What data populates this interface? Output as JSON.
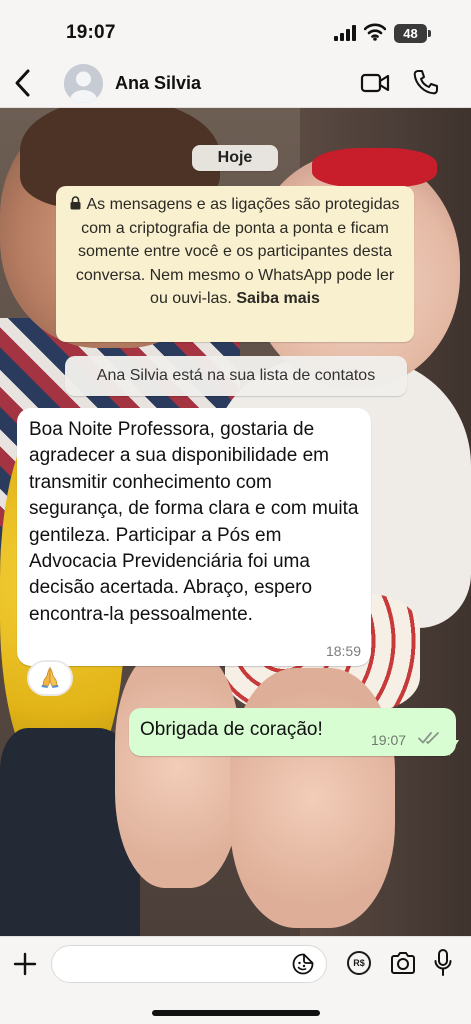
{
  "status_bar": {
    "time": "19:07",
    "battery_level": "48",
    "icons": [
      "signal-icon",
      "wifi-icon",
      "battery-icon"
    ]
  },
  "header": {
    "contact_name": "Ana Silvia",
    "icons": [
      "back-arrow-icon",
      "avatar-icon",
      "video-call-icon",
      "phone-icon"
    ]
  },
  "chat": {
    "date_chip": "Hoje",
    "encryption_notice": {
      "text": "As mensagens e as ligações são protegidas com a criptografia de ponta a ponta e ficam somente entre você e os participantes desta conversa. Nem mesmo o WhatsApp pode ler ou ouvi-las.",
      "link": "Saiba mais"
    },
    "contact_notice": "Ana Silvia está na sua lista de contatos",
    "messages": [
      {
        "direction": "incoming",
        "text": "Boa Noite Professora, gostaria de agradecer a sua disponibilidade em transmitir conhecimento com segurança, de forma clara e com muita gentileza. Participar a Pós em Advocacia Previdenciária foi uma decisão acertada. Abraço, espero encontra-la pessoalmente.",
        "time": "18:59",
        "reaction": "praying-hands-icon"
      },
      {
        "direction": "outgoing",
        "text": "Obrigada de coração!",
        "time": "19:07",
        "status": "read"
      }
    ]
  },
  "input_bar": {
    "placeholder": "",
    "pix_label": "R$",
    "icons": [
      "plus-icon",
      "sticker-icon",
      "pix-icon",
      "camera-icon",
      "mic-icon"
    ]
  },
  "colors": {
    "incoming_bubble": "#ffffff",
    "outgoing_bubble": "#d8fdd2",
    "notice_bubble": "#f9f0cf",
    "bar_background": "#f6f5f3"
  }
}
